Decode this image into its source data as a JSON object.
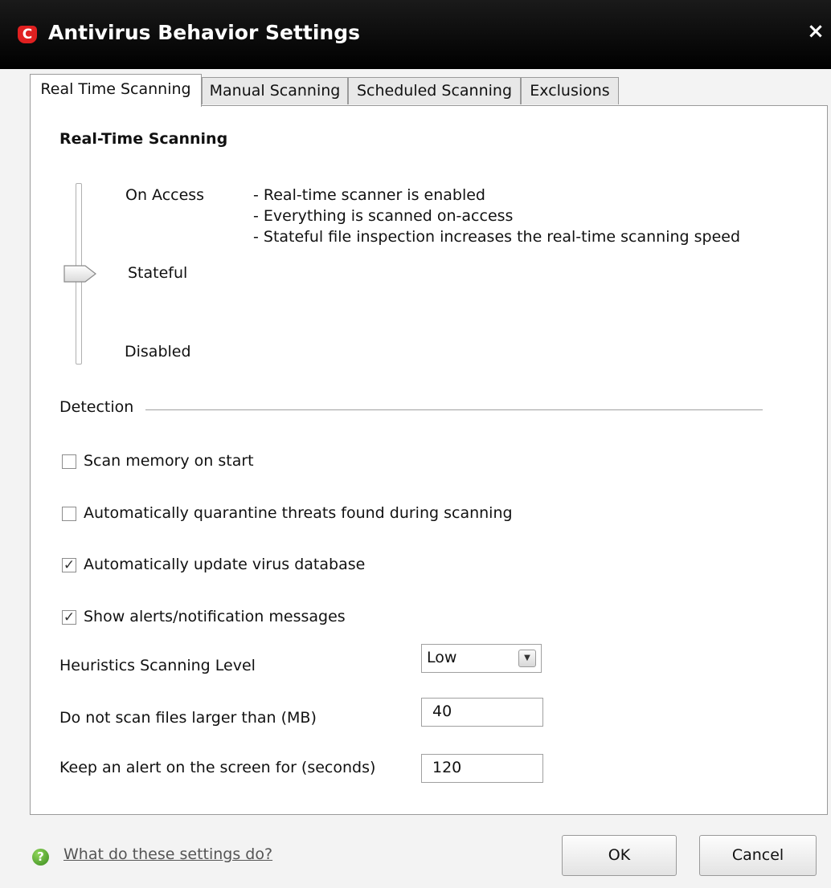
{
  "window": {
    "title": "Antivirus Behavior Settings",
    "logo_letter": "C",
    "close_glyph": "×"
  },
  "tabs": [
    {
      "label": "Real Time Scanning",
      "active": true
    },
    {
      "label": "Manual Scanning",
      "active": false
    },
    {
      "label": "Scheduled Scanning",
      "active": false
    },
    {
      "label": "Exclusions",
      "active": false
    }
  ],
  "section_title": "Real-Time Scanning",
  "slider": {
    "levels": [
      "On Access",
      "Stateful",
      "Disabled"
    ],
    "selected": "Stateful",
    "description": [
      "- Real-time scanner is enabled",
      "- Everything is scanned on-access",
      "- Stateful file inspection increases the real-time scanning speed"
    ]
  },
  "detection_label": "Detection",
  "checkboxes": [
    {
      "label": "Scan memory on start",
      "checked": false,
      "mark": ""
    },
    {
      "label": "Automatically quarantine threats found during scanning",
      "checked": false,
      "mark": ""
    },
    {
      "label": "Automatically update virus database",
      "checked": true,
      "mark": "✓"
    },
    {
      "label": "Show alerts/notification messages",
      "checked": true,
      "mark": "✓"
    }
  ],
  "settings": {
    "heuristics_label": "Heuristics Scanning Level",
    "heuristics_value": "Low",
    "max_size_label": "Do not scan files larger than (MB)",
    "max_size_value": "40",
    "alert_label": "Keep an alert on the screen for (seconds)",
    "alert_value": "120"
  },
  "footer": {
    "help_glyph": "?",
    "help_link": "What do these settings do?",
    "ok_label": "OK",
    "cancel_label": "Cancel"
  },
  "colors": {
    "titlebar": "#000000",
    "logo": "#e02020",
    "help_icon": "#4caf2a"
  },
  "icons": [
    "comodo-logo-icon",
    "close-icon",
    "slider-thumb-icon",
    "checkbox-icon",
    "chevron-down-icon",
    "help-icon"
  ]
}
